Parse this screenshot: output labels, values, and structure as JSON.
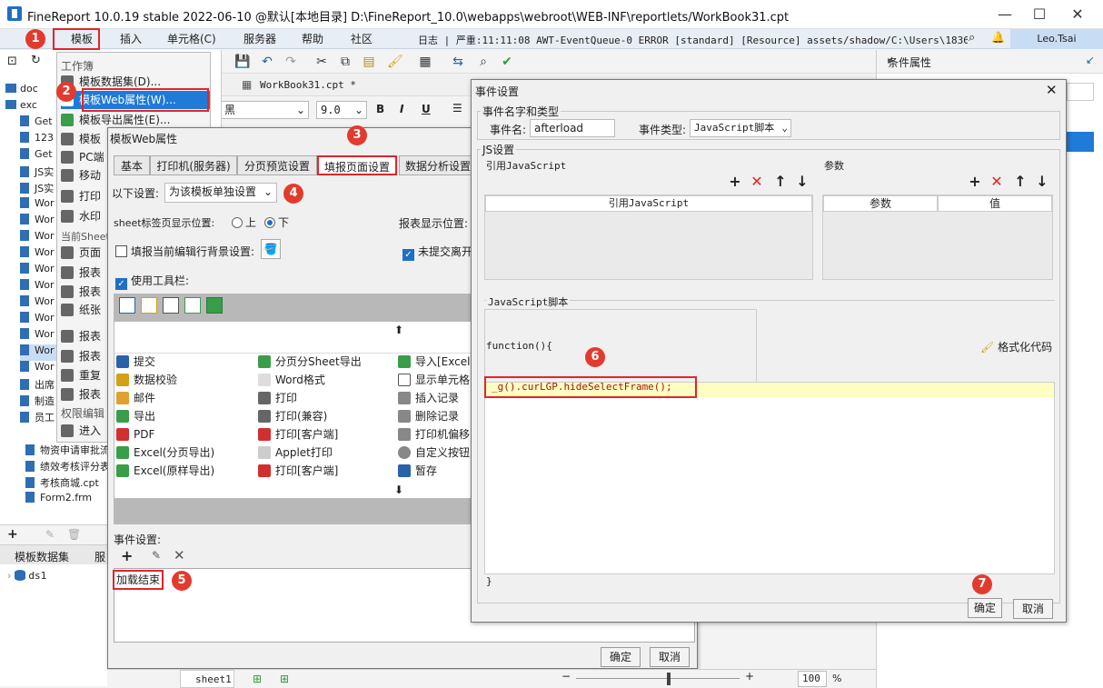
{
  "app": {
    "title": "FineReport 10.0.19 stable 2022-06-10 @默认[本地目录]    D:\\FineReport_10.0\\webapps\\webroot\\WEB-INF\\reportlets/WorkBook31.cpt",
    "win_min": "—",
    "win_max": "☐",
    "win_close": "✕"
  },
  "menubar": {
    "items": [
      "模板",
      "插入",
      "单元格(C)",
      "服务器",
      "帮助",
      "社区"
    ],
    "log": "日志 | 严重:11:11:08 AWT-EventQueue-0 ERROR [standard] [Resource] assets/shadow/C:\\Users\\18366\\De...",
    "user": "Leo.Tsai"
  },
  "left_tree": {
    "items": [
      "doc",
      "exc",
      "Get",
      "123",
      "Get",
      "JS实",
      "JS实",
      "Wor",
      "Wor",
      "Wor",
      "Wor",
      "Wor",
      "Wor",
      "Wor",
      "Wor",
      "Wor",
      "Wor",
      "Wor",
      "出席",
      "制造",
      "员工",
      "物资申请审批流",
      "绩效考核评分表",
      "考核商城.cpt",
      "Form2.frm"
    ],
    "bottom_tabs": [
      "模板数据集",
      "服"
    ],
    "datasource": "ds1"
  },
  "dropdown": {
    "section1": "工作簿",
    "items": [
      "模板数据集(D)...",
      "模板Web属性(W)...",
      "模板导出属性(E)...",
      "模板",
      "PC端",
      "移动",
      "打印",
      "水印"
    ],
    "section2": "当前Sheet",
    "items2": [
      "页面",
      "报表",
      "报表",
      "纸张"
    ],
    "items3": [
      "报表",
      "报表",
      "重复",
      "报表"
    ],
    "section3": "权限编辑",
    "items4": [
      "进入"
    ]
  },
  "editor": {
    "tab_name": "WorkBook31.cpt *",
    "font_name": "黑",
    "font_size": "9.0",
    "sheet_tab": "sheet1",
    "zoom": "100",
    "zoom_unit": "%"
  },
  "right_panel": {
    "title": "条件属性"
  },
  "dialog_web": {
    "title": "模板Web属性",
    "tabs": [
      "基本",
      "打印机(服务器)",
      "分页预览设置",
      "填报页面设置",
      "数据分析设置"
    ],
    "setting_label": "以下设置:",
    "setting_value": "为该模板单独设置",
    "sheet_pos_label": "sheet标签页显示位置:",
    "radio_top": "上",
    "radio_bottom": "下",
    "report_pos_label": "报表显示位置:",
    "bg_label": "填报当前编辑行背景设置:",
    "unsubmitted_label": "未提交离开",
    "toolbar_label": "使用工具栏:",
    "col1": [
      "提交",
      "数据校验",
      "邮件",
      "导出",
      "PDF",
      "Excel(分页导出)",
      "Excel(原样导出)"
    ],
    "col2": [
      "分页分Sheet导出",
      "Word格式",
      "打印",
      "打印(兼容)",
      "打印[客户端]",
      "Applet打印",
      "打印[客户端]"
    ],
    "col3": [
      "导入[Excel",
      "显示单元格",
      "插入记录",
      "删除记录",
      "打印机偏移",
      "自定义按钮",
      "暂存"
    ],
    "event_label": "事件设置:",
    "event_item": "加载结束",
    "ok": "确定",
    "cancel": "取消"
  },
  "dialog_event": {
    "title": "事件设置",
    "group1": "事件名字和类型",
    "name_label": "事件名:",
    "name_value": "afterload",
    "type_label": "事件类型:",
    "type_value": "JavaScript脚本",
    "group2": "JS设置",
    "ref_js_label": "引用JavaScript",
    "param_label": "参数",
    "col_ref": "引用JavaScript",
    "col_param": "参数",
    "col_value": "值",
    "script_label": "JavaScript脚本",
    "func_open": "function(){",
    "format_label": "格式化代码",
    "code": "_g().curLGP.hideSelectFrame();",
    "func_close": "}",
    "ok": "确定",
    "cancel": "取消"
  },
  "badges": [
    "1",
    "2",
    "3",
    "4",
    "5",
    "6",
    "7"
  ],
  "colors": {
    "accent": "#1f6fc5",
    "highlight_red": "#e0252b",
    "badge": "#e23b2e",
    "code_bg": "#fffec2"
  }
}
